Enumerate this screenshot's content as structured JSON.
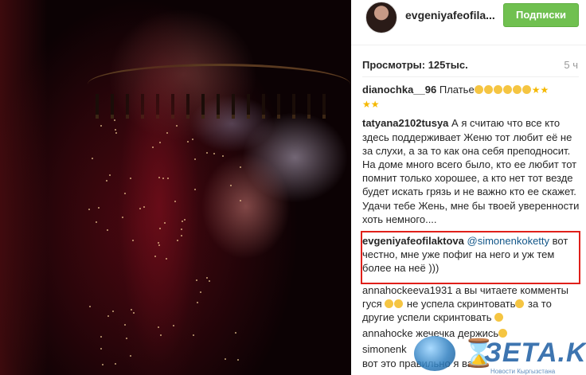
{
  "header": {
    "username": "evgeniyafeofila...",
    "follow_label": "Подписки"
  },
  "meta": {
    "views": "Просмотры: 125тыс.",
    "time": "5 ч"
  },
  "comments": [
    {
      "user": "dianochka__96",
      "text": "Платье"
    },
    {
      "user": "tatyana2102tusya",
      "text": "А я считаю что все кто здесь поддерживает Женю тот любит её не за слухи, а за то как она себя преподносит. На доме много всего было, кто ее любит тот помнит только хорошее, а кто нет тот везде будет искать грязь и не важно кто ее скажет. Удачи тебе Жень, мне бы твоей уверенности хоть немного...."
    },
    {
      "user": "evgeniyafeofilaktova",
      "mention": "@simonenkoketty",
      "text": "вот честно, мне уже пофиг на него и уж тем более на неё )))"
    },
    {
      "user": "annahockeeva1931",
      "text": "а вы читаете комменты гуся",
      "text2": "не успела скринтовать",
      "text3": "за то другие успели скринтовать"
    },
    {
      "user": "annahocke",
      "text": "жечечка держись"
    },
    {
      "user": "simonenk",
      "text": "вот это правильно",
      "text2": "я вас"
    }
  ],
  "watermark": {
    "brand": "ЗЕТА.KG",
    "sub": "Новости Кыргызстана"
  }
}
